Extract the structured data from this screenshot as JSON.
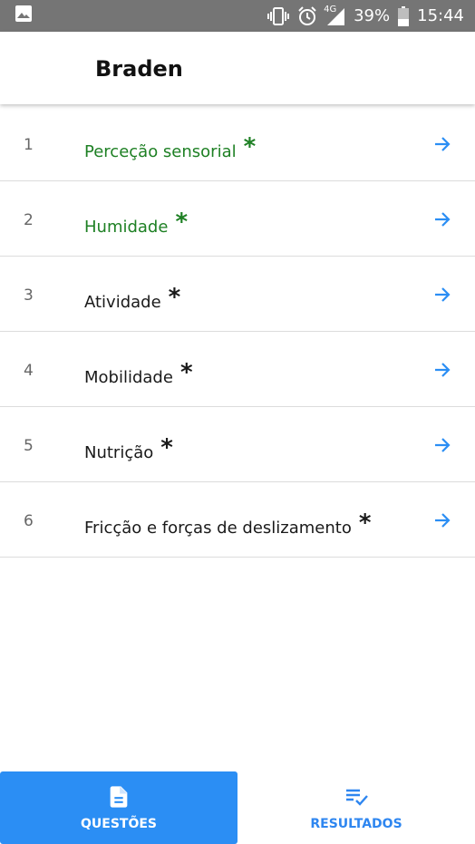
{
  "status_bar": {
    "network": "4G",
    "battery": "39%",
    "time": "15:44",
    "icons": [
      "image-icon",
      "vibrate-icon",
      "alarm-icon",
      "signal-icon",
      "battery-icon"
    ]
  },
  "app_bar": {
    "title": "Braden"
  },
  "questions": [
    {
      "number": "1",
      "label": "Perceção sensorial",
      "marker": "*",
      "answered": true
    },
    {
      "number": "2",
      "label": "Humidade",
      "marker": "*",
      "answered": true
    },
    {
      "number": "3",
      "label": "Atividade",
      "marker": "*",
      "answered": false
    },
    {
      "number": "4",
      "label": "Mobilidade",
      "marker": "*",
      "answered": false
    },
    {
      "number": "5",
      "label": "Nutrição",
      "marker": "*",
      "answered": false
    },
    {
      "number": "6",
      "label": "Fricção e forças de deslizamento",
      "marker": "*",
      "answered": false
    }
  ],
  "bottom_nav": {
    "questions_label": "QUESTÕES",
    "results_label": "RESULTADOS",
    "active": "questions"
  },
  "colors": {
    "accent": "#2b8ef4",
    "answered": "#1e8024",
    "status_bar": "#757575"
  }
}
